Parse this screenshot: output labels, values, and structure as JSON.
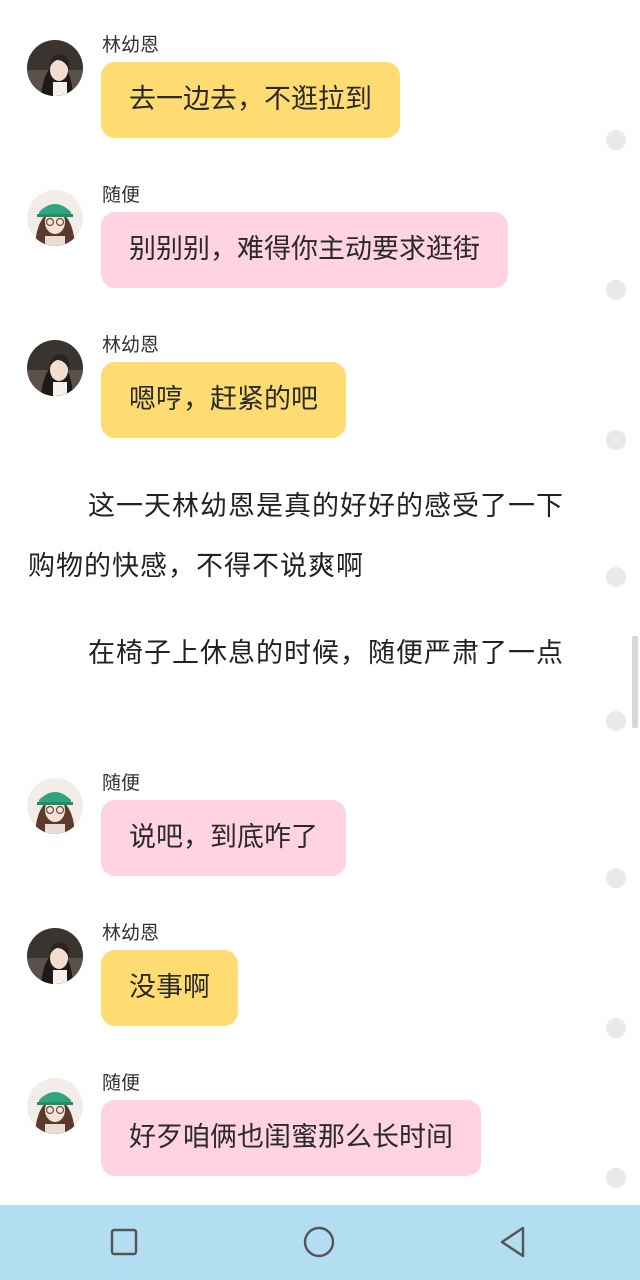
{
  "messages": [
    {
      "sender": "林幼恩",
      "text": "去一边去，不逛拉到",
      "color": "yellow"
    },
    {
      "sender": "随便",
      "text": "别别别，难得你主动要求逛街",
      "color": "pink"
    },
    {
      "sender": "林幼恩",
      "text": "嗯哼，赶紧的吧",
      "color": "yellow"
    },
    {
      "sender": "随便",
      "text": "说吧，到底咋了",
      "color": "pink"
    },
    {
      "sender": "林幼恩",
      "text": "没事啊",
      "color": "yellow"
    },
    {
      "sender": "随便",
      "text": "好歹咱俩也闺蜜那么长时间",
      "color": "pink"
    }
  ],
  "narration": [
    "这一天林幼恩是真的好好的感受了一下购物的快感，不得不说爽啊",
    "在椅子上休息的时候，随便严肃了一点"
  ],
  "colors": {
    "bubble_yellow": "#fedc72",
    "bubble_pink": "#ffd3df",
    "nav_bar": "#b3def2"
  },
  "navbar": {
    "icons": [
      "recent-apps-icon",
      "home-icon",
      "back-icon"
    ]
  }
}
